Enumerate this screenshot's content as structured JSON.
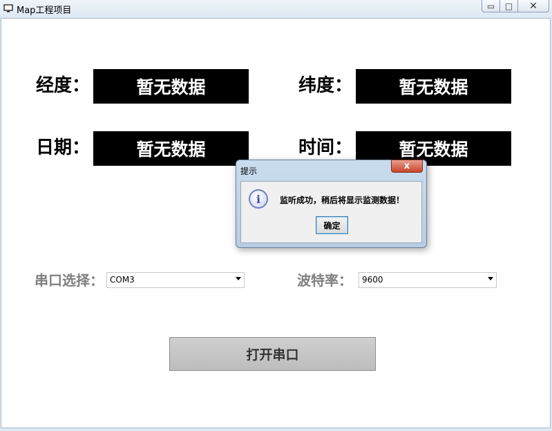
{
  "window": {
    "title": "Map工程项目",
    "minimize_glyph": "▭",
    "maximize_glyph": "□",
    "close_glyph": "✕"
  },
  "fields": {
    "longitude": {
      "label": "经度：",
      "value": "暂无数据"
    },
    "latitude": {
      "label": "纬度：",
      "value": "暂无数据"
    },
    "date": {
      "label": "日期：",
      "value": "暂无数据"
    },
    "time": {
      "label": "时间：",
      "value": "暂无数据"
    }
  },
  "serial": {
    "port_label": "串口选择：",
    "port_value": "COM3",
    "baud_label": "波特率：",
    "baud_value": "9600",
    "open_button": "打开串口"
  },
  "dialog": {
    "title": "提示",
    "close_glyph": "x",
    "icon_glyph": "i",
    "message": "监听成功，稍后将显示监测数据！",
    "ok_label": "确定"
  },
  "icons": {
    "app": "monitor-icon",
    "info": "info-icon",
    "dropdown": "chevron-down-icon"
  }
}
